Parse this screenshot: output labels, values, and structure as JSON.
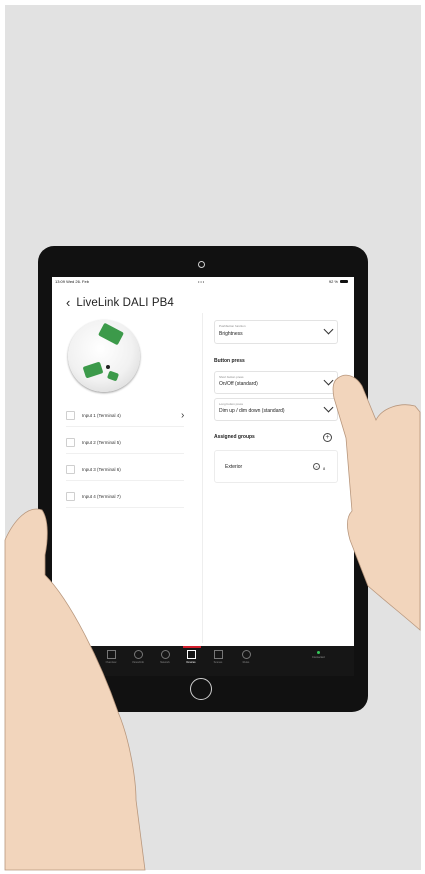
{
  "status_bar": {
    "time": "13:09  Wed 26. Feb",
    "dots": "•••",
    "battery": "92 %"
  },
  "header": {
    "back_icon": "chevron-left-icon",
    "title": "LiveLink DALI PB4"
  },
  "inputs": [
    {
      "label": "Input 1 (Terminal 4)"
    },
    {
      "label": "Input 2 (Terminal 5)"
    },
    {
      "label": "Input 3 (Terminal 6)"
    },
    {
      "label": "Input 4 (Terminal 7)"
    }
  ],
  "pushbutton_function": {
    "label": "Pushbutton function",
    "value": "Brightness"
  },
  "button_press": {
    "title": "Button press",
    "short": {
      "label": "Short button press",
      "value": "On/Off (standard)"
    },
    "long": {
      "label": "Long button press",
      "value": "Dim up / dim down (standard)"
    }
  },
  "assigned_groups": {
    "title": "Assigned groups",
    "add_icon": "plus-circle-icon",
    "items": [
      {
        "name": "Exterior",
        "count": "8"
      }
    ]
  },
  "tabbar": {
    "tabs": [
      {
        "label": "Overview",
        "icon": "grid-icon"
      },
      {
        "label": "Views/Info",
        "icon": "layers-icon"
      },
      {
        "label": "Network",
        "icon": "network-icon"
      },
      {
        "label": "Devices",
        "icon": "device-icon",
        "active": true
      },
      {
        "label": "Scenes",
        "icon": "scene-icon"
      },
      {
        "label": "Rules",
        "icon": "rules-icon"
      }
    ],
    "connection": "Connected"
  },
  "colors": {
    "accent": "#d21f2c",
    "terminal_green": "#3c9a4a",
    "connected": "#34c759",
    "bezel": "#111111"
  }
}
